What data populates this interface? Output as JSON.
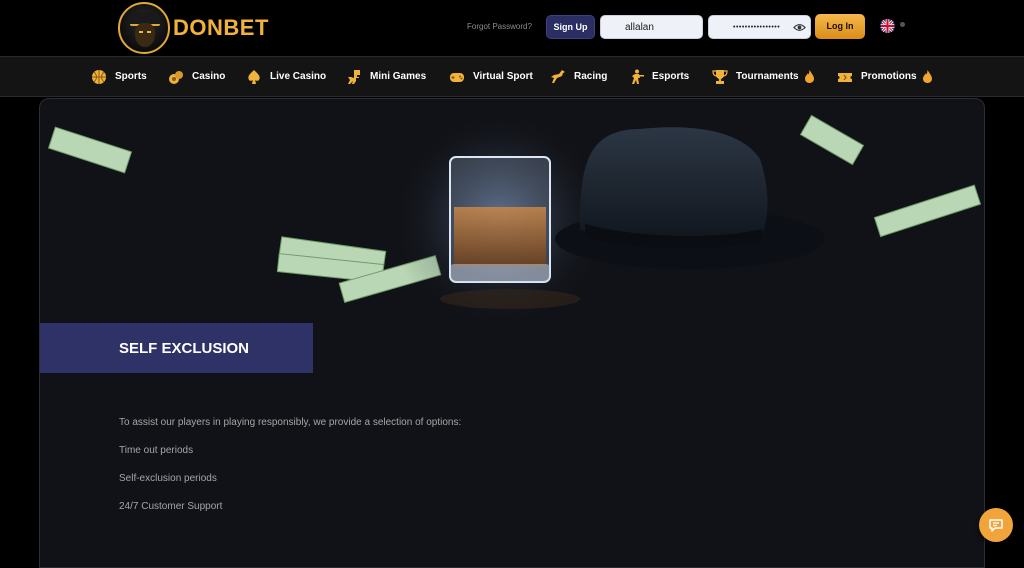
{
  "header": {
    "brand": "DONBET",
    "forgot_password": "Forgot Password?",
    "signup_label": "Sign Up",
    "username_value": "allalan",
    "password_value": "••••••••••••••••",
    "login_label": "Log In",
    "language_icon": "uk-flag-icon"
  },
  "nav": {
    "items": [
      {
        "label": "Sports",
        "icon": "basketball-icon"
      },
      {
        "label": "Casino",
        "icon": "chips-icon"
      },
      {
        "label": "Live Casino",
        "icon": "spade-icon"
      },
      {
        "label": "Mini Games",
        "icon": "dinosaur-icon"
      },
      {
        "label": "Virtual Sport",
        "icon": "gamepad-icon"
      },
      {
        "label": "Racing",
        "icon": "horse-icon"
      },
      {
        "label": "Esports",
        "icon": "soldier-icon"
      },
      {
        "label": "Tournaments",
        "icon": "trophy-icon"
      },
      {
        "label": "Promotions",
        "icon": "ticket-icon"
      }
    ]
  },
  "page": {
    "title": "SELF EXCLUSION",
    "intro": "To assist our players in playing responsibly, we provide a selection of options:",
    "options": [
      "Time out periods",
      "Self-exclusion periods",
      "24/7 Customer Support"
    ]
  },
  "colors": {
    "accent_gold": "#f0b23a",
    "signup_bg": "#2a2e63",
    "title_bar_bg": "#2e3266",
    "panel_bg": "#111217"
  }
}
